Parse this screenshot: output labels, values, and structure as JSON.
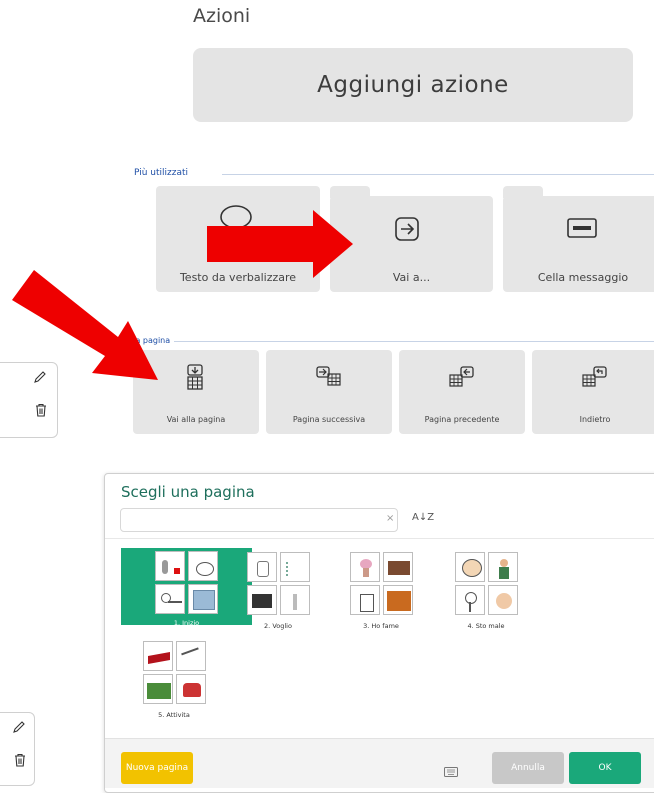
{
  "header": {
    "title": "Azioni",
    "add_action_label": "Aggiungi azione"
  },
  "sections": {
    "most_used_label": "Più utilizzati",
    "page_label": "lla pagina"
  },
  "most_used": [
    {
      "label": "Testo da verbalizzare",
      "icon": "speech-bubble-icon"
    },
    {
      "label": "Vai a...",
      "icon": "arrow-right-box-icon"
    },
    {
      "label": "Cella messaggio",
      "icon": "message-bar-icon"
    }
  ],
  "page_actions": [
    {
      "label": "Vai alla pagina",
      "icon": "go-to-page-icon"
    },
    {
      "label": "Pagina successiva",
      "icon": "next-page-icon"
    },
    {
      "label": "Pagina precedente",
      "icon": "previous-page-icon"
    },
    {
      "label": "Indietro",
      "icon": "back-icon"
    }
  ],
  "dialog": {
    "title": "Scegli una pagina",
    "search_value": "",
    "clear_glyph": "×",
    "sort_glyph": "A↓Z",
    "pages": [
      {
        "label": "1. Inizio",
        "selected": true
      },
      {
        "label": "2. Voglio",
        "selected": false
      },
      {
        "label": "3. Ho fame",
        "selected": false
      },
      {
        "label": "4. Sto male",
        "selected": false
      },
      {
        "label": "5. Attivita",
        "selected": false
      }
    ],
    "new_page_label": "Nuova pagina",
    "cancel_label": "Annulla",
    "ok_label": "OK"
  },
  "colors": {
    "accent_green": "#1aa87a",
    "new_page_yellow": "#f2c200",
    "arrow_red": "#ee0000",
    "section_blue": "#1f4fa6"
  }
}
